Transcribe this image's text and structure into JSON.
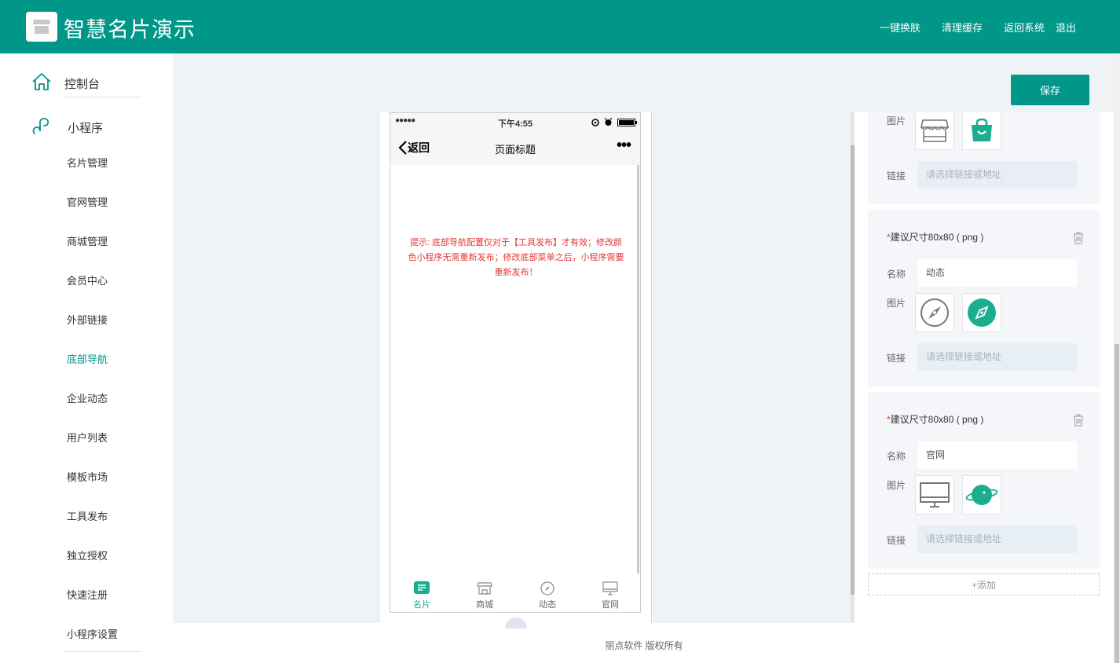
{
  "header": {
    "title": "智慧名片演示",
    "nav": {
      "skin": "一键换肤",
      "cache": "清理缓存",
      "back": "返回系统",
      "quit": "退出"
    }
  },
  "sidebar": {
    "dashboard": "控制台",
    "miniprogram": "小程序",
    "items": [
      "名片管理",
      "官网管理",
      "商城管理",
      "会员中心",
      "外部链接",
      "底部导航",
      "企业动态",
      "用户列表",
      "模板市场",
      "工具发布",
      "独立授权",
      "快速注册",
      "小程序设置"
    ],
    "active": "底部导航"
  },
  "toolbar": {
    "save": "保存"
  },
  "phone": {
    "time": "下午4:55",
    "signal": "●●●●●",
    "back": "返回",
    "title": "页面标题",
    "more": "•••",
    "hint": "提示: 底部导航配置仅对于【工具发布】才有效；修改颜色小程序无需重新发布；修改底部菜单之后，小程序需要重新发布！",
    "tabs": [
      {
        "label": "名片",
        "icon": "card-icon"
      },
      {
        "label": "商城",
        "icon": "shop-icon"
      },
      {
        "label": "动态",
        "icon": "compass-icon"
      },
      {
        "label": "官网",
        "icon": "monitor-icon"
      }
    ],
    "active_tab": "名片"
  },
  "panel": {
    "labels": {
      "name": "名称",
      "image": "图片",
      "link": "链接"
    },
    "size_hint": "建议尺寸80x80 ( png )",
    "link_placeholder": "请选择链接或地址",
    "cards": [
      {
        "name": "",
        "icons": [
          "shop-icon",
          "bag-icon"
        ]
      },
      {
        "name": "动态",
        "icons": [
          "compass-icon",
          "compass-active-icon"
        ]
      },
      {
        "name": "官网",
        "icons": [
          "monitor-icon",
          "planet-icon"
        ]
      }
    ],
    "add": "+添加"
  },
  "footer": "丽点软件 版权所有",
  "colors": {
    "primary": "#009688",
    "hint": "#e53935",
    "tab_active": "#1aad8e"
  }
}
